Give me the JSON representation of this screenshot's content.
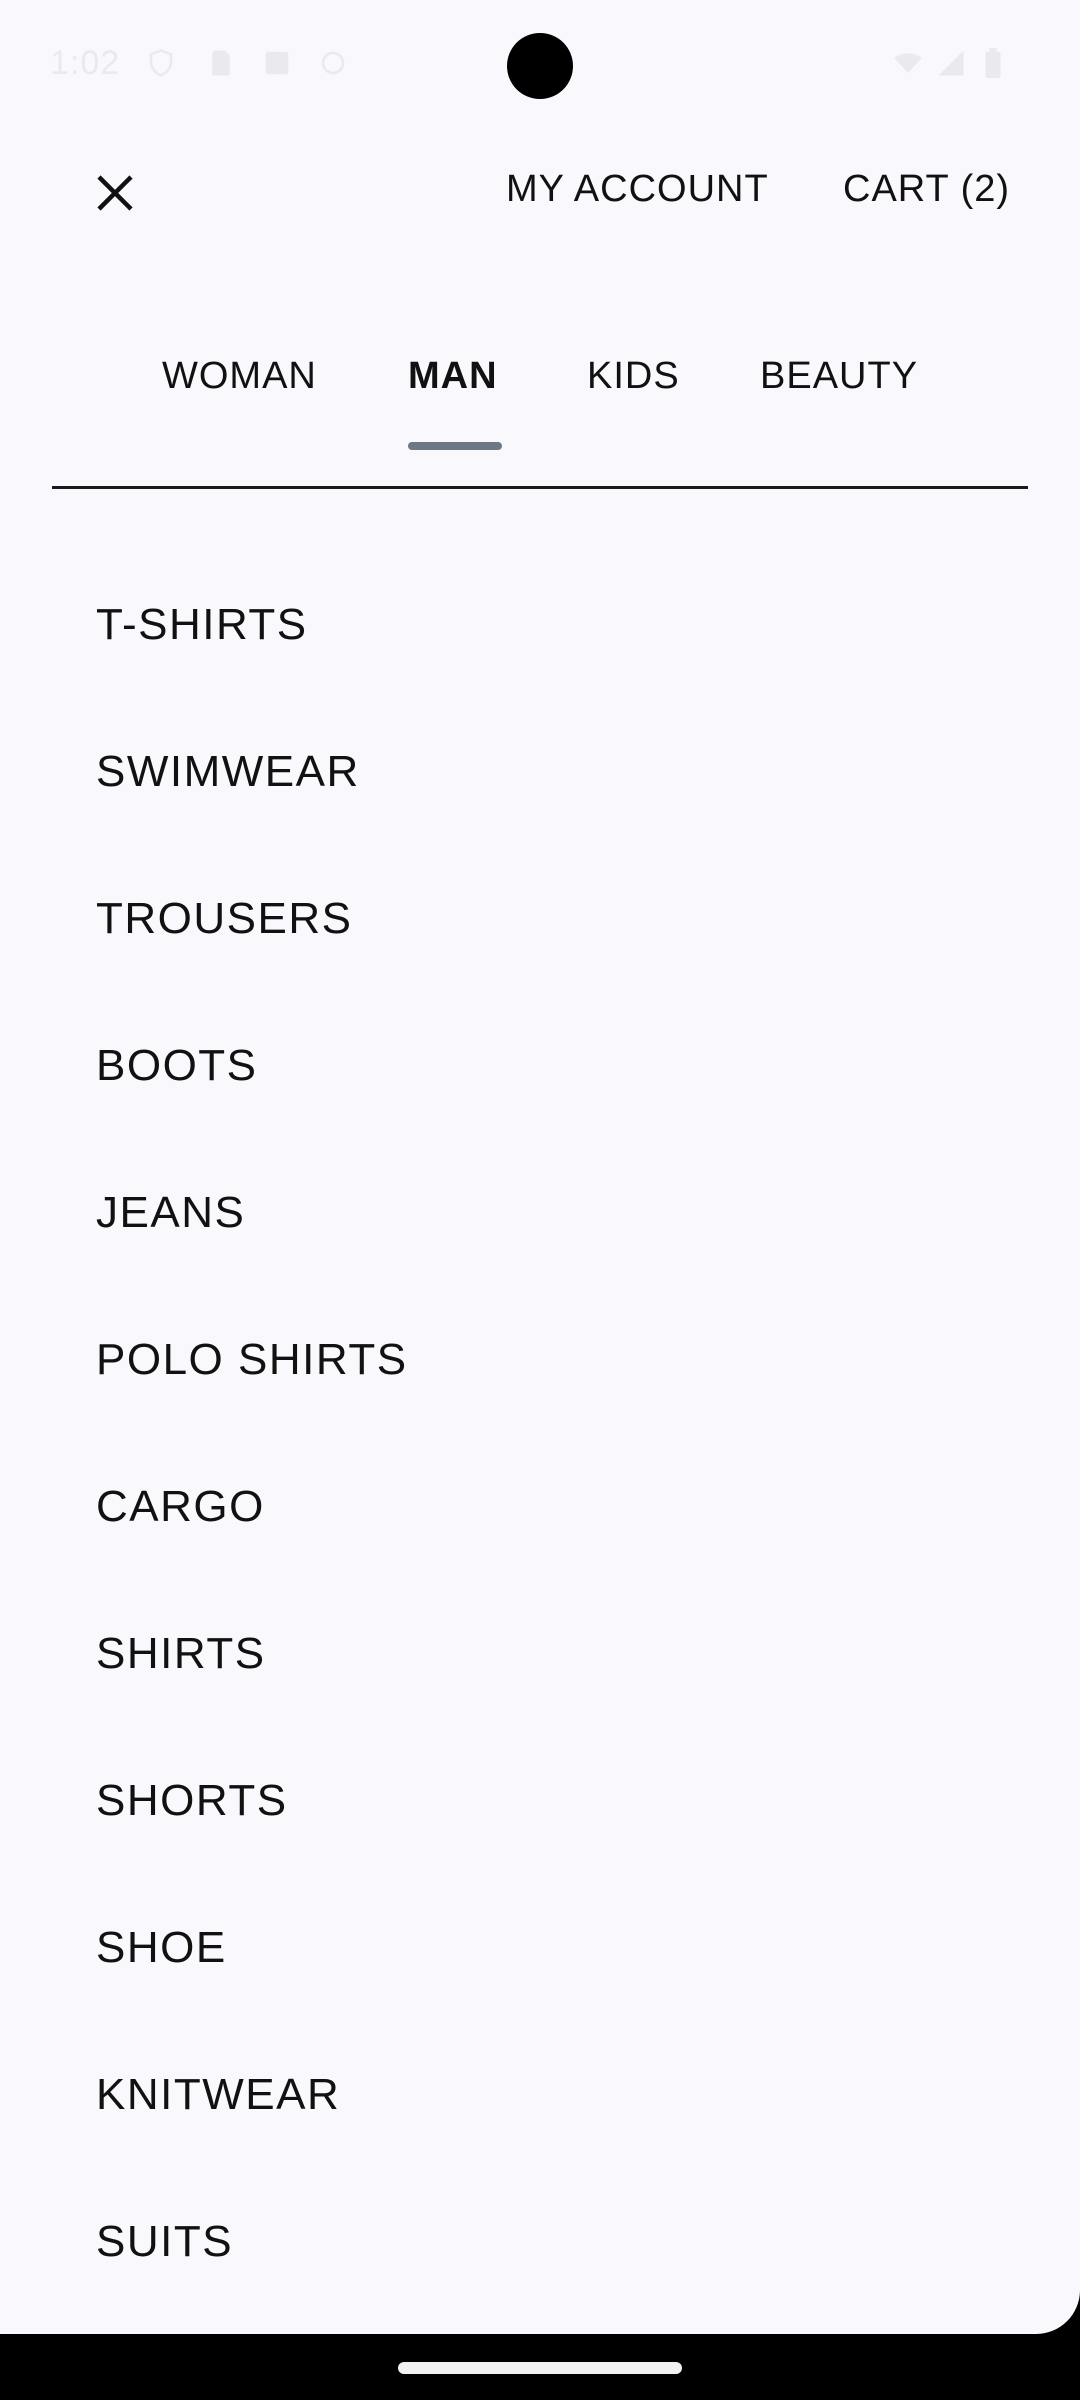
{
  "status_bar": {
    "time": "1:02"
  },
  "header": {
    "my_account_label": "MY ACCOUNT",
    "cart_label": "CART (2)"
  },
  "tabs": [
    {
      "label": "WOMAN",
      "active": false
    },
    {
      "label": "MAN",
      "active": true
    },
    {
      "label": "KIDS",
      "active": false
    },
    {
      "label": "BEAUTY",
      "active": false
    }
  ],
  "categories": [
    {
      "label": "T-SHIRTS"
    },
    {
      "label": "SWIMWEAR"
    },
    {
      "label": "TROUSERS"
    },
    {
      "label": "BOOTS"
    },
    {
      "label": "JEANS"
    },
    {
      "label": "POLO SHIRTS"
    },
    {
      "label": "CARGO"
    },
    {
      "label": "SHIRTS"
    },
    {
      "label": "SHORTS"
    },
    {
      "label": "SHOE"
    },
    {
      "label": "KNITWEAR"
    },
    {
      "label": "SUITS"
    }
  ],
  "colors": {
    "background": "#f8f8fd",
    "text": "#111111",
    "tab_indicator": "#6f7785"
  },
  "icons": {
    "close": "close-icon",
    "status": [
      "shield-icon",
      "sim-card-icon",
      "photo-icon",
      "data-saver-icon",
      "wifi-icon",
      "signal-icon",
      "battery-icon"
    ]
  }
}
